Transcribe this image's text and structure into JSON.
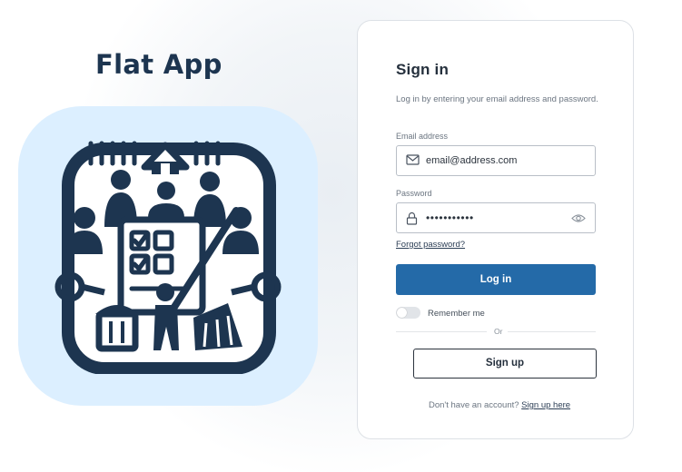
{
  "brand": {
    "title": "Flat App"
  },
  "signin": {
    "title": "Sign in",
    "subtitle": "Log in by entering your email address and password.",
    "email_label": "Email address",
    "email_value": "email@address.com",
    "password_label": "Password",
    "password_value": "•••••••••••",
    "forgot_link": "Forgot password?",
    "login_button": "Log in",
    "remember_label": "Remember me",
    "divider_text": "Or",
    "signup_button": "Sign up",
    "footer_text": "Don't have an account?",
    "footer_link": "Sign up here"
  },
  "icons": [
    "house-icon",
    "people-icon",
    "checklist-icon",
    "broom-icon",
    "trash-bin-icon",
    "envelope-icon",
    "lock-icon",
    "eye-icon"
  ],
  "colors": {
    "primary": "#246aa8",
    "brand_dark": "#1d3550",
    "logo_bg": "#dcefff"
  }
}
